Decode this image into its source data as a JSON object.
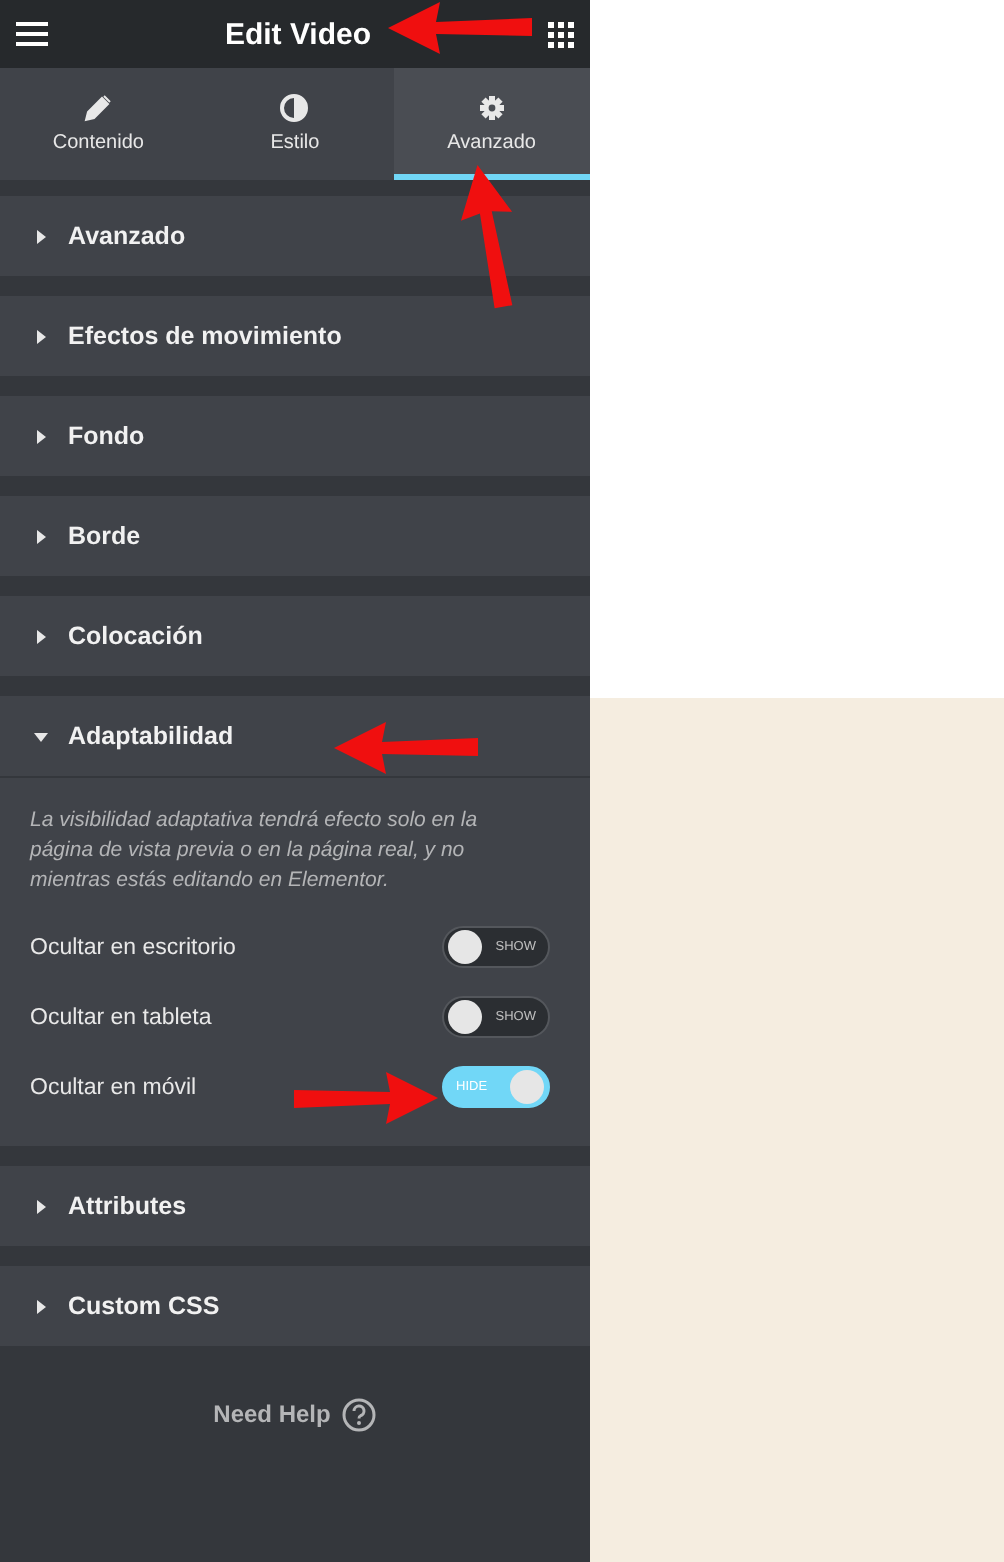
{
  "header": {
    "title": "Edit Video"
  },
  "tabs": [
    {
      "label": "Contenido",
      "kind": "pencil",
      "selected": false
    },
    {
      "label": "Estilo",
      "kind": "contrast",
      "selected": false
    },
    {
      "label": "Avanzado",
      "kind": "gear",
      "selected": true
    }
  ],
  "sections": [
    {
      "title": "Avanzado",
      "expanded": false
    },
    {
      "title": "Efectos de movimiento",
      "expanded": false
    },
    {
      "title": "Fondo",
      "expanded": false
    },
    {
      "title": "Borde",
      "expanded": false
    },
    {
      "title": "Colocación",
      "expanded": false
    },
    {
      "title": "Adaptabilidad",
      "expanded": true,
      "note": "La visibilidad adaptativa tendrá efecto solo en la página de vista previa o en la página real, y no mientras estás editando en Elementor.",
      "controls": [
        {
          "label": "Ocultar en escritorio",
          "on": false,
          "switch_text": "SHOW"
        },
        {
          "label": "Ocultar en tableta",
          "on": false,
          "switch_text": "SHOW"
        },
        {
          "label": "Ocultar en móvil",
          "on": true,
          "switch_text": "HIDE"
        }
      ]
    },
    {
      "title": "Attributes",
      "expanded": false
    },
    {
      "title": "Custom CSS",
      "expanded": false
    }
  ],
  "footer": {
    "help": "Need Help"
  }
}
